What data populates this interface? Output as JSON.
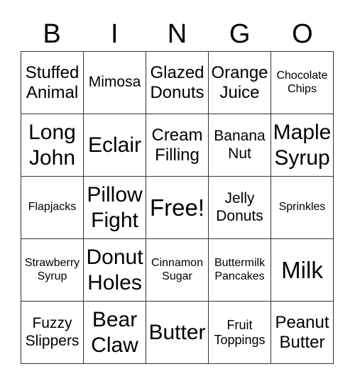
{
  "header": [
    "B",
    "I",
    "N",
    "G",
    "O"
  ],
  "cells": [
    {
      "text": "Stuffed Animal",
      "size": "s4"
    },
    {
      "text": "Mimosa",
      "size": "s3"
    },
    {
      "text": "Glazed Donuts",
      "size": "s4"
    },
    {
      "text": "Orange Juice",
      "size": "s4"
    },
    {
      "text": "Chocolate Chips",
      "size": "s1"
    },
    {
      "text": "Long John",
      "size": "s5"
    },
    {
      "text": "Eclair",
      "size": "s5"
    },
    {
      "text": "Cream Filling",
      "size": "s4"
    },
    {
      "text": "Banana Nut",
      "size": "s3"
    },
    {
      "text": "Maple Syrup",
      "size": "s5"
    },
    {
      "text": "Flapjacks",
      "size": "s1"
    },
    {
      "text": "Pillow Fight",
      "size": "s5"
    },
    {
      "text": "Free!",
      "size": "s6"
    },
    {
      "text": "Jelly Donuts",
      "size": "s3"
    },
    {
      "text": "Sprinkles",
      "size": "s1"
    },
    {
      "text": "Strawberry Syrup",
      "size": "s1"
    },
    {
      "text": "Donut Holes",
      "size": "s5"
    },
    {
      "text": "Cinnamon Sugar",
      "size": "s1"
    },
    {
      "text": "Buttermilk Pancakes",
      "size": "s1"
    },
    {
      "text": "Milk",
      "size": "s6"
    },
    {
      "text": "Fuzzy Slippers",
      "size": "s3"
    },
    {
      "text": "Bear Claw",
      "size": "s5"
    },
    {
      "text": "Butter",
      "size": "s5"
    },
    {
      "text": "Fruit Toppings",
      "size": "s2"
    },
    {
      "text": "Peanut Butter",
      "size": "s4"
    }
  ]
}
